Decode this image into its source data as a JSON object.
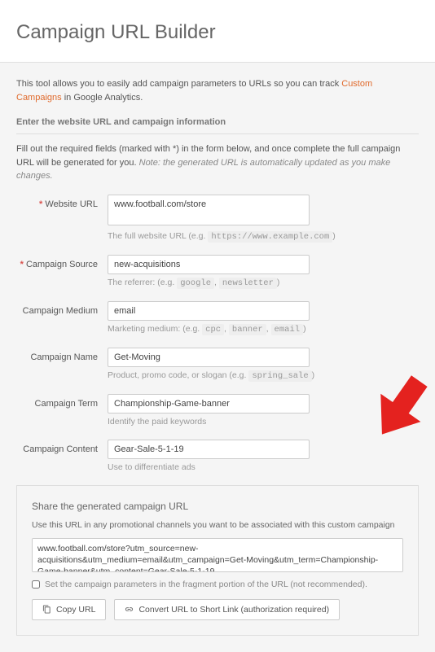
{
  "header": {
    "title": "Campaign URL Builder"
  },
  "intro": {
    "prefix": "This tool allows you to easily add campaign parameters to URLs so you can track ",
    "link": "Custom Campaigns",
    "suffix": " in Google Analytics."
  },
  "section_heading": "Enter the website URL and campaign information",
  "instructions": {
    "main": "Fill out the required fields (marked with *) in the form below, and once complete the full campaign URL will be generated for you. ",
    "note": "Note: the generated URL is automatically updated as you make changes."
  },
  "fields": {
    "website_url": {
      "label": "Website URL",
      "required": "*",
      "value": "www.football.com/store",
      "helper_pre": "The full website URL (e.g. ",
      "helper_code": "https://www.example.com",
      "helper_post": ")"
    },
    "campaign_source": {
      "label": "Campaign Source",
      "required": "*",
      "value": "new-acquisitions",
      "helper_pre": "The referrer: (e.g. ",
      "helper_code1": "google",
      "helper_sep": ", ",
      "helper_code2": "newsletter",
      "helper_post": ")"
    },
    "campaign_medium": {
      "label": "Campaign Medium",
      "value": "email",
      "helper_pre": "Marketing medium: (e.g. ",
      "helper_code1": "cpc",
      "helper_code2": "banner",
      "helper_code3": "email",
      "helper_sep": ", ",
      "helper_post": ")"
    },
    "campaign_name": {
      "label": "Campaign Name",
      "value": "Get-Moving",
      "helper_pre": "Product, promo code, or slogan (e.g. ",
      "helper_code": "spring_sale",
      "helper_post": ")"
    },
    "campaign_term": {
      "label": "Campaign Term",
      "value": "Championship-Game-banner",
      "helper": "Identify the paid keywords"
    },
    "campaign_content": {
      "label": "Campaign Content",
      "value": "Gear-Sale-5-1-19",
      "helper": "Use to differentiate ads"
    }
  },
  "share": {
    "title": "Share the generated campaign URL",
    "sub": "Use this URL in any promotional channels you want to be associated with this custom campaign",
    "url": "www.football.com/store?utm_source=new-acquisitions&utm_medium=email&utm_campaign=Get-Moving&utm_term=Championship-Game-banner&utm_content=Gear-Sale-5-1-19",
    "checkbox_label": "Set the campaign parameters in the fragment portion of the URL (not recommended).",
    "copy_btn": "Copy URL",
    "convert_btn": "Convert URL to Short Link (authorization required)"
  }
}
